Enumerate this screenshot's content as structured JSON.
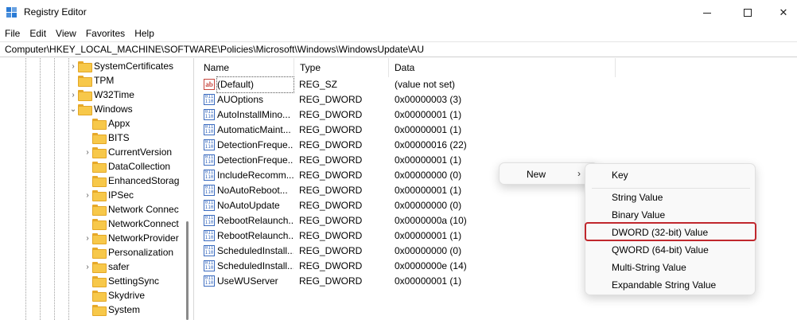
{
  "window": {
    "title": "Registry Editor",
    "controls": {
      "minimize": "—",
      "maximize": "☐",
      "close": "✕"
    }
  },
  "menu": [
    "File",
    "Edit",
    "View",
    "Favorites",
    "Help"
  ],
  "address": "Computer\\HKEY_LOCAL_MACHINE\\SOFTWARE\\Policies\\Microsoft\\Windows\\WindowsUpdate\\AU",
  "tree": {
    "items": [
      {
        "label": "SystemCertificates",
        "expander": "›"
      },
      {
        "label": "TPM",
        "expander": ""
      },
      {
        "label": "W32Time",
        "expander": "›"
      },
      {
        "label": "Windows",
        "expander": "⌄"
      },
      {
        "label": "Appx",
        "expander": ""
      },
      {
        "label": "BITS",
        "expander": ""
      },
      {
        "label": "CurrentVersion",
        "expander": "›"
      },
      {
        "label": "DataCollection",
        "expander": ""
      },
      {
        "label": "EnhancedStorag",
        "expander": ""
      },
      {
        "label": "IPSec",
        "expander": "›"
      },
      {
        "label": "Network Connec",
        "expander": ""
      },
      {
        "label": "NetworkConnect",
        "expander": ""
      },
      {
        "label": "NetworkProvider",
        "expander": "›"
      },
      {
        "label": "Personalization",
        "expander": ""
      },
      {
        "label": "safer",
        "expander": "›"
      },
      {
        "label": "SettingSync",
        "expander": ""
      },
      {
        "label": "Skydrive",
        "expander": ""
      },
      {
        "label": "System",
        "expander": ""
      }
    ]
  },
  "values": {
    "columns": [
      "Name",
      "Type",
      "Data"
    ],
    "rows": [
      {
        "icon": "string-value-icon",
        "glyph": "ab",
        "name": "(Default)",
        "type": "REG_SZ",
        "data": "(value not set)"
      },
      {
        "icon": "binary-value-icon",
        "glyph": "011\n110",
        "name": "AUOptions",
        "type": "REG_DWORD",
        "data": "0x00000003 (3)"
      },
      {
        "icon": "binary-value-icon",
        "glyph": "011\n110",
        "name": "AutoInstallMino...",
        "type": "REG_DWORD",
        "data": "0x00000001 (1)"
      },
      {
        "icon": "binary-value-icon",
        "glyph": "011\n110",
        "name": "AutomaticMaint...",
        "type": "REG_DWORD",
        "data": "0x00000001 (1)"
      },
      {
        "icon": "binary-value-icon",
        "glyph": "011\n110",
        "name": "DetectionFreque...",
        "type": "REG_DWORD",
        "data": "0x00000016 (22)"
      },
      {
        "icon": "binary-value-icon",
        "glyph": "011\n110",
        "name": "DetectionFreque...",
        "type": "REG_DWORD",
        "data": "0x00000001 (1)"
      },
      {
        "icon": "binary-value-icon",
        "glyph": "011\n110",
        "name": "IncludeRecomm...",
        "type": "REG_DWORD",
        "data": "0x00000000 (0)"
      },
      {
        "icon": "binary-value-icon",
        "glyph": "011\n110",
        "name": "NoAutoReboot...",
        "type": "REG_DWORD",
        "data": "0x00000001 (1)"
      },
      {
        "icon": "binary-value-icon",
        "glyph": "011\n110",
        "name": "NoAutoUpdate",
        "type": "REG_DWORD",
        "data": "0x00000000 (0)"
      },
      {
        "icon": "binary-value-icon",
        "glyph": "011\n110",
        "name": "RebootRelaunch...",
        "type": "REG_DWORD",
        "data": "0x0000000a (10)"
      },
      {
        "icon": "binary-value-icon",
        "glyph": "011\n110",
        "name": "RebootRelaunch...",
        "type": "REG_DWORD",
        "data": "0x00000001 (1)"
      },
      {
        "icon": "binary-value-icon",
        "glyph": "011\n110",
        "name": "ScheduledInstall...",
        "type": "REG_DWORD",
        "data": "0x00000000 (0)"
      },
      {
        "icon": "binary-value-icon",
        "glyph": "011\n110",
        "name": "ScheduledInstall...",
        "type": "REG_DWORD",
        "data": "0x0000000e (14)"
      },
      {
        "icon": "binary-value-icon",
        "glyph": "011\n110",
        "name": "UseWUServer",
        "type": "REG_DWORD",
        "data": "0x00000001 (1)"
      }
    ]
  },
  "context_menu": {
    "new_label": "New",
    "new_arrow": "›",
    "submenu": [
      "Key",
      "String Value",
      "Binary Value",
      "DWORD (32-bit) Value",
      "QWORD (64-bit) Value",
      "Multi-String Value",
      "Expandable String Value"
    ],
    "highlighted": "DWORD (32-bit) Value"
  },
  "colors": {
    "highlight": "#c0272d",
    "folder": "#f7c84a",
    "dword_icon": "#3b6bbf",
    "string_icon": "#c6463e"
  }
}
